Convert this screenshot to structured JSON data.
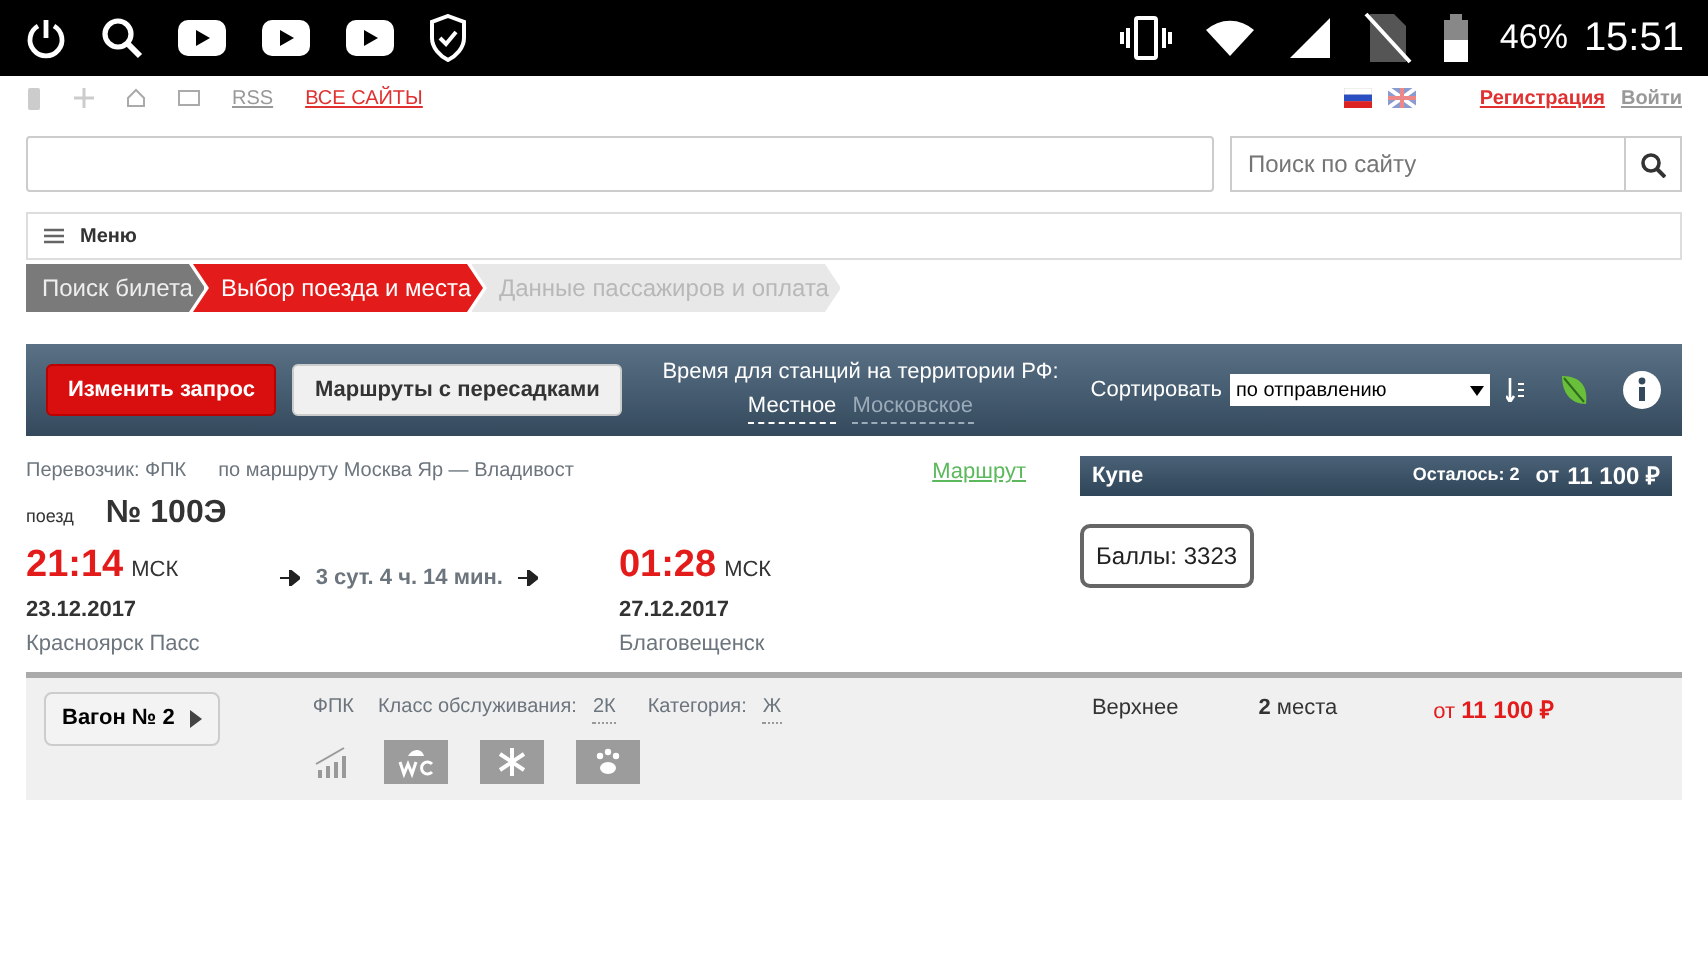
{
  "status_bar": {
    "battery": "46%",
    "time": "15:51"
  },
  "top_links": [
    "RSS",
    "ВСЕ САЙТЫ"
  ],
  "auth_links": [
    "Регистрация",
    "Войти"
  ],
  "search": {
    "placeholder": "Поиск по сайту"
  },
  "menu": "Меню",
  "steps": [
    {
      "label": "Поиск билета",
      "kind": "done"
    },
    {
      "label": "Выбор поезда и места",
      "kind": "current"
    },
    {
      "label": "Данные пассажиров и оплата",
      "kind": "pending"
    }
  ],
  "toolbar": {
    "change_button": "Изменить запрос",
    "transfers_button": "Маршруты с пересадками",
    "time_label": "Время для станций на территории РФ:",
    "time_options": [
      {
        "label": "Местное",
        "selected": true
      },
      {
        "label": "Московское",
        "selected": false
      }
    ],
    "sort_label": "Сортировать",
    "sort_value": "по отправлению"
  },
  "train": {
    "carrier": "Перевозчик: ФПК",
    "route": "по маршруту Москва Яр — Владивост",
    "route_link": "Маршрут",
    "train_label": "поезд",
    "number": "№ 100Э",
    "departure": {
      "time": "21:14",
      "zone": "МСК",
      "date": "23.12.2017",
      "station": "Красноярск Пасс"
    },
    "duration": "3 сут. 4 ч. 14 мин.",
    "arrival": {
      "time": "01:28",
      "zone": "МСК",
      "date": "27.12.2017",
      "station": "Благовещенск"
    }
  },
  "class_panel": {
    "name": "Купе",
    "remaining": "Осталось: 2",
    "price_prefix": "от",
    "price": "11 100 ₽",
    "points": "Баллы: 3323"
  },
  "wagon": {
    "button": "Вагон № 2",
    "carrier": "ФПК",
    "service_label": "Класс обслуживания:",
    "service": "2К",
    "category_label": "Категория:",
    "category": "Ж",
    "seat_type": "Верхнее",
    "seats_count": "2",
    "seats_word": "места",
    "price_prefix": "от",
    "price": "11 100 ₽"
  }
}
